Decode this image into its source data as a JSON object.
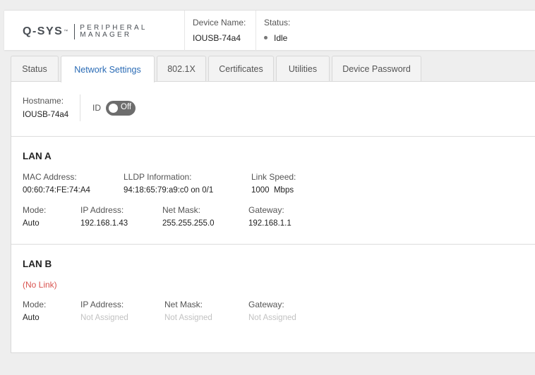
{
  "header": {
    "logo": {
      "brand": "Q-SYS",
      "tm": "™",
      "product_line1": "PERIPHERAL",
      "product_line2": "MANAGER"
    },
    "device_name_label": "Device Name:",
    "device_name_value": "IOUSB-74a4",
    "status_label": "Status:",
    "status_value": "Idle"
  },
  "tabs": [
    {
      "label": "Status"
    },
    {
      "label": "Network Settings"
    },
    {
      "label": "802.1X"
    },
    {
      "label": "Certificates"
    },
    {
      "label": "Utilities"
    },
    {
      "label": "Device Password"
    }
  ],
  "active_tab": "Network Settings",
  "hostname": {
    "label": "Hostname:",
    "value": "IOUSB-74a4"
  },
  "id_toggle": {
    "label": "ID",
    "state": "Off"
  },
  "lan_a": {
    "title": "LAN A",
    "mac_label": "MAC Address:",
    "mac_value": "00:60:74:FE:74:A4",
    "lldp_label": "LLDP Information:",
    "lldp_value": "94:18:65:79:a9:c0 on 0/1",
    "speed_label": "Link Speed:",
    "speed_value": "1000  Mbps",
    "mode_label": "Mode:",
    "mode_value": "Auto",
    "ip_label": "IP Address:",
    "ip_value": "192.168.1.43",
    "mask_label": "Net Mask:",
    "mask_value": "255.255.255.0",
    "gateway_label": "Gateway:",
    "gateway_value": "192.168.1.1"
  },
  "lan_b": {
    "title": "LAN B",
    "link_status": "(No Link)",
    "mode_label": "Mode:",
    "mode_value": "Auto",
    "ip_label": "IP Address:",
    "ip_value": "Not Assigned",
    "mask_label": "Net Mask:",
    "mask_value": "Not Assigned",
    "gateway_label": "Gateway:",
    "gateway_value": "Not Assigned"
  },
  "colors": {
    "accent": "#2a6bb5",
    "no_link": "#d9534f",
    "toggle_off": "#6d6d6d",
    "not_assigned": "#c2c2c2"
  }
}
